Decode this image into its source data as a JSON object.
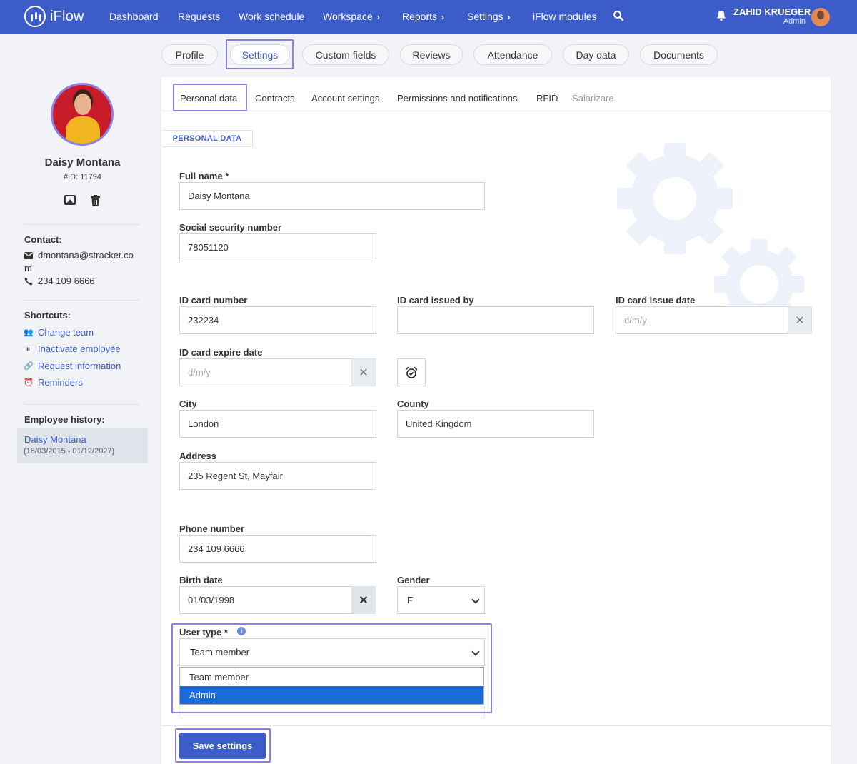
{
  "app": {
    "name": "iFlow"
  },
  "nav": {
    "items": [
      "Dashboard",
      "Requests",
      "Work schedule",
      "Workspace",
      "Reports",
      "Settings",
      "iFlow modules"
    ],
    "user_name": "ZAHID KRUEGER",
    "user_role": "Admin"
  },
  "profile_tabs": [
    "Profile",
    "Settings",
    "Custom fields",
    "Reviews",
    "Attendance",
    "Day data",
    "Documents"
  ],
  "active_profile_tab": "Settings",
  "employee": {
    "name": "Daisy Montana",
    "id": "#ID: 11794",
    "contact_title": "Contact:",
    "email_line1": "dmontana@stracker.co",
    "email_line2": "m",
    "phone": "234 109 6666",
    "shortcuts_title": "Shortcuts:",
    "shortcuts": [
      "Change team",
      "Inactivate employee",
      "Request information",
      "Reminders"
    ],
    "history_title": "Employee history:",
    "history_name": "Daisy Montana",
    "history_dates": "(18/03/2015 - 01/12/2027)"
  },
  "sub_tabs": [
    "Personal data",
    "Contracts",
    "Account settings",
    "Permissions and notifications",
    "RFID",
    "Salarizare"
  ],
  "section_tag": "PERSONAL DATA",
  "form": {
    "full_name": {
      "label": "Full name *",
      "value": "Daisy Montana"
    },
    "ssn": {
      "label": "Social security number",
      "value": "78051120"
    },
    "id_card_number": {
      "label": "ID card number",
      "value": "232234"
    },
    "id_card_issued_by": {
      "label": "ID card issued by",
      "value": ""
    },
    "id_card_issue_date": {
      "label": "ID card issue date",
      "placeholder": "d/m/y"
    },
    "id_card_expire_date": {
      "label": "ID card expire date",
      "placeholder": "d/m/y"
    },
    "city": {
      "label": "City",
      "value": "London"
    },
    "county": {
      "label": "County",
      "value": "United Kingdom"
    },
    "address": {
      "label": "Address",
      "value": "235 Regent St, Mayfair"
    },
    "phone_number": {
      "label": "Phone number",
      "value": "234 109 6666"
    },
    "birth_date": {
      "label": "Birth date",
      "value": "01/03/1998"
    },
    "gender": {
      "label": "Gender",
      "value": "F"
    },
    "user_type": {
      "label": "User type *",
      "value": "Team member",
      "options": [
        "Team member",
        "Admin"
      ],
      "highlighted_option": "Admin"
    }
  },
  "save_label": "Save settings",
  "colors": {
    "primary": "#3b5cc9",
    "highlight": "#8a80e8",
    "dropdown_selected": "#1a6ad8"
  }
}
